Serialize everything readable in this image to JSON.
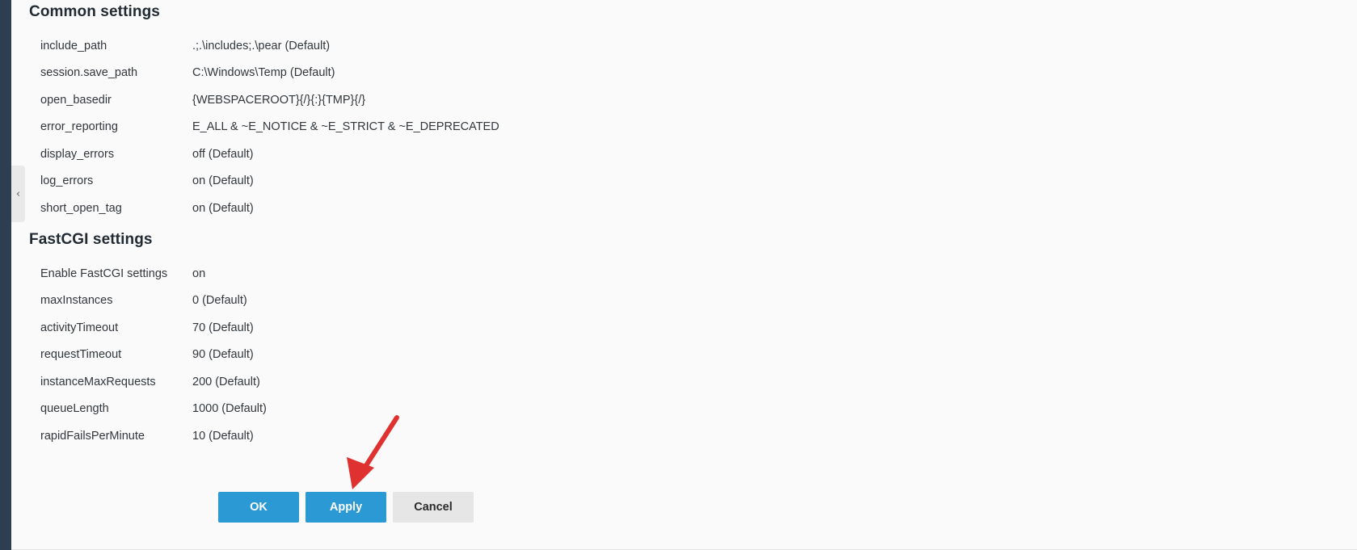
{
  "window": {
    "background_color": "#fafafa",
    "nav_rail_color": "#2d3e50"
  },
  "sidebar": {
    "collapse_handle": {
      "icon": "chevron-left-icon",
      "glyph": "‹"
    }
  },
  "sections": [
    {
      "id": "common-settings",
      "title": "Common settings",
      "rows": [
        {
          "key": "include_path",
          "value": ".;.\\includes;.\\pear (Default)"
        },
        {
          "key": "session.save_path",
          "value": "C:\\Windows\\Temp (Default)"
        },
        {
          "key": "open_basedir",
          "value": "{WEBSPACEROOT}{/}{:}{TMP}{/}"
        },
        {
          "key": "error_reporting",
          "value": "E_ALL & ~E_NOTICE & ~E_STRICT & ~E_DEPRECATED"
        },
        {
          "key": "display_errors",
          "value": "off (Default)"
        },
        {
          "key": "log_errors",
          "value": "on (Default)"
        },
        {
          "key": "short_open_tag",
          "value": "on (Default)"
        }
      ]
    },
    {
      "id": "fastcgi-settings",
      "title": "FastCGI settings",
      "rows": [
        {
          "key": "Enable FastCGI settings",
          "value": "on"
        },
        {
          "key": "maxInstances",
          "value": "0 (Default)"
        },
        {
          "key": "activityTimeout",
          "value": "70 (Default)"
        },
        {
          "key": "requestTimeout",
          "value": "90 (Default)"
        },
        {
          "key": "instanceMaxRequests",
          "value": "200 (Default)"
        },
        {
          "key": "queueLength",
          "value": "1000 (Default)"
        },
        {
          "key": "rapidFailsPerMinute",
          "value": "10 (Default)"
        }
      ]
    }
  ],
  "buttons": {
    "ok_label": "OK",
    "apply_label": "Apply",
    "cancel_label": "Cancel",
    "primary_color": "#2a99d4",
    "secondary_color": "#e6e6e6"
  },
  "annotation": {
    "arrow_color": "#e03131",
    "target": "apply-button"
  }
}
